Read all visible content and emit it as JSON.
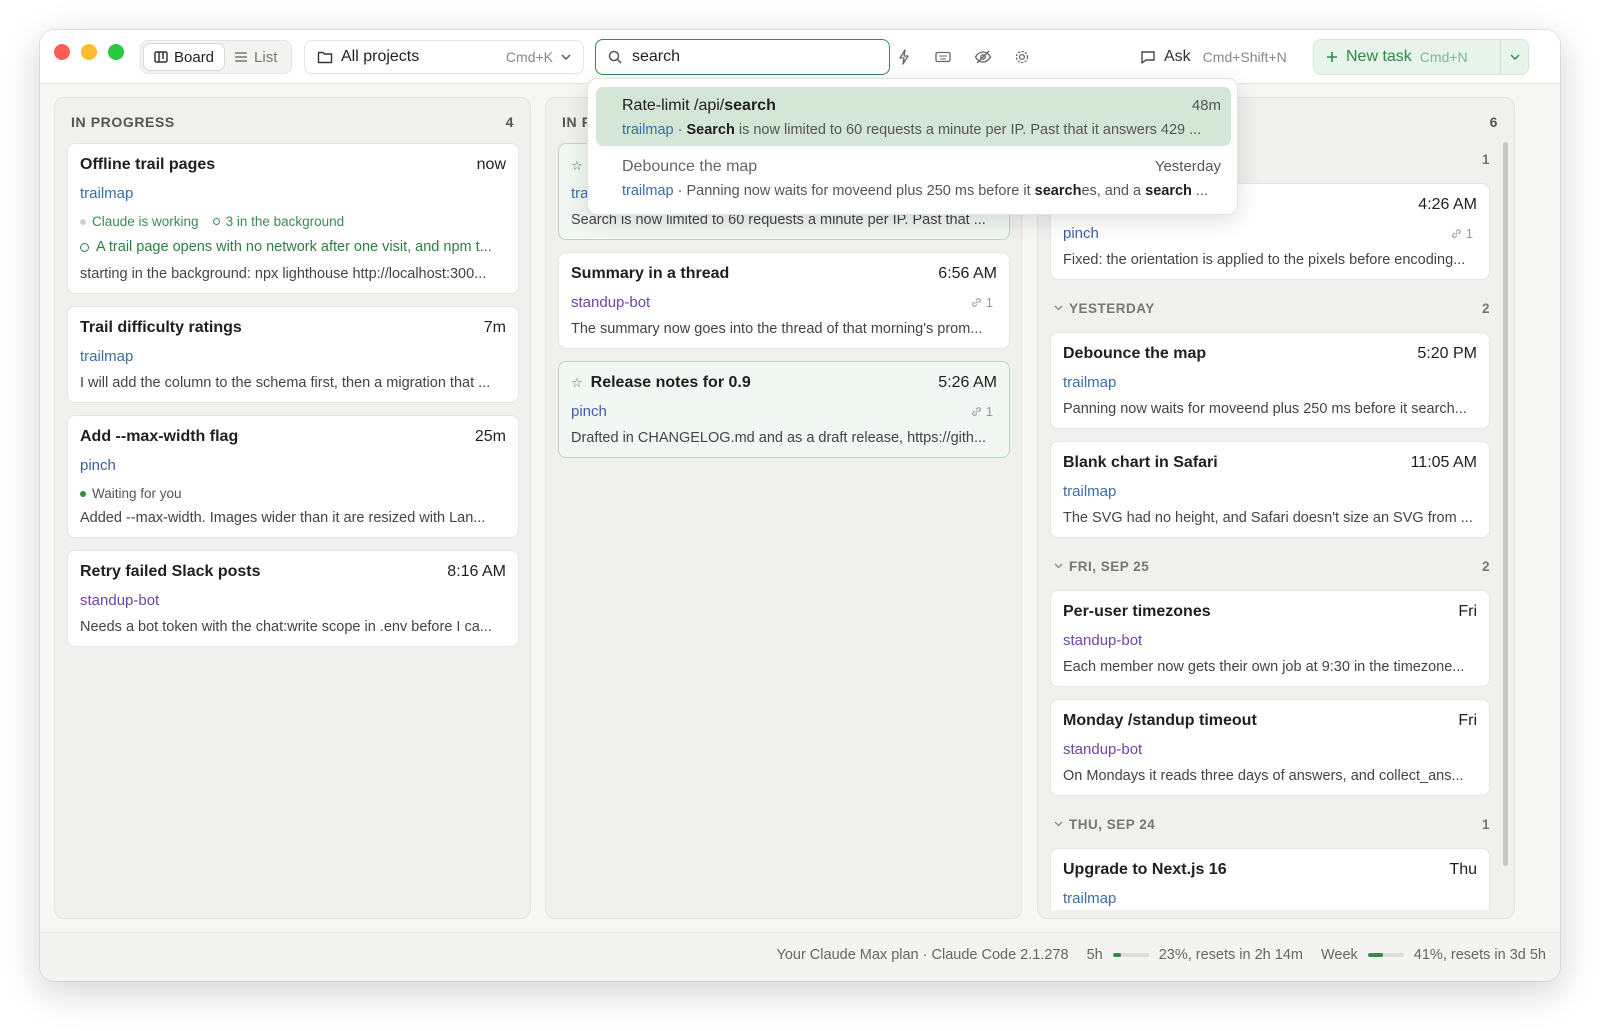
{
  "toolbar": {
    "view_board": "Board",
    "view_list": "List",
    "projects_label": "All projects",
    "projects_kbd": "Cmd+K",
    "search_value": "search",
    "ask_label": "Ask",
    "ask_kbd": "Cmd+Shift+N",
    "new_task_label": "New task",
    "new_task_kbd": "Cmd+N"
  },
  "col1": {
    "title": "IN PROGRESS",
    "count": "4",
    "cards": [
      {
        "title": "Offline trail pages",
        "time": "now",
        "project": "trailmap",
        "status1": "Claude is working",
        "status2": "3 in the background",
        "line1": "A trail page opens with no network after one visit, and npm t...",
        "line2": "starting in the background: npx lighthouse http://localhost:300..."
      },
      {
        "title": "Trail difficulty ratings",
        "time": "7m",
        "project": "trailmap",
        "line1": "I will add the column to the schema first, then a migration that ..."
      },
      {
        "title": "Add --max-width flag",
        "time": "25m",
        "project": "pinch",
        "status1": "Waiting for you",
        "line1": "Added --max-width. Images wider than it are resized with Lan..."
      },
      {
        "title": "Retry failed Slack posts",
        "time": "8:16 AM",
        "project": "standup-bot",
        "line1": "Needs a bot token with the chat:write scope in .env before I ca..."
      }
    ]
  },
  "col2": {
    "title": "IN R",
    "cards": [
      {
        "project": "tra",
        "line1": "Search is now limited to 60 requests a minute per IP. Past that ..."
      },
      {
        "title": "Summary in a thread",
        "time": "6:56 AM",
        "project": "standup-bot",
        "links": "1",
        "line1": "The summary now goes into the thread of that morning's prom..."
      },
      {
        "title": "Release notes for 0.9",
        "time": "5:26 AM",
        "project": "pinch",
        "links": "1",
        "line1": "Drafted in CHANGELOG.md and as a draft release, https://gith..."
      }
    ]
  },
  "col3": {
    "count": "6",
    "groups": [
      {
        "count": "1"
      },
      {
        "label": "YESTERDAY",
        "count": "2"
      },
      {
        "label": "FRI, SEP 25",
        "count": "2"
      },
      {
        "label": "THU, SEP 24",
        "count": "1"
      }
    ],
    "cards": [
      {
        "time": "4:26 AM",
        "project": "pinch",
        "links": "1",
        "line1": "Fixed: the orientation is applied to the pixels before encoding..."
      },
      {
        "title": "Debounce the map",
        "time": "5:20 PM",
        "project": "trailmap",
        "line1": "Panning now waits for moveend plus 250 ms before it search..."
      },
      {
        "title": "Blank chart in Safari",
        "time": "11:05 AM",
        "project": "trailmap",
        "line1": "The SVG had no height, and Safari doesn't size an SVG from ..."
      },
      {
        "title": "Per-user timezones",
        "time": "Fri",
        "project": "standup-bot",
        "line1": "Each member now gets their own job at 9:30 in the timezone..."
      },
      {
        "title": "Monday /standup timeout",
        "time": "Fri",
        "project": "standup-bot",
        "line1": "On Mondays it reads three days of answers, and collect_ans..."
      },
      {
        "title": "Upgrade to Next.js 16",
        "time": "Thu",
        "project": "trailmap"
      }
    ]
  },
  "dropdown": {
    "items": [
      {
        "title_pre": "Rate-limit /api/",
        "title_bold": "search",
        "time": "48m",
        "project": "trailmap",
        "sep": " · ",
        "sub_bold": "Search",
        "sub_rest": " is now limited to 60 requests a minute per IP. Past that it answers 429 ..."
      },
      {
        "title": "Debounce the map",
        "time": "Yesterday",
        "project": "trailmap",
        "sep": " · ",
        "sub_pre": "Panning now waits for moveend plus 250 ms before it ",
        "sub_bold1": "search",
        "sub_mid": "es, and a ",
        "sub_bold2": "search",
        "sub_end": " ..."
      }
    ]
  },
  "statusbar": {
    "plan": "Your Claude Max plan · Claude Code 2.1.278",
    "five_h_label": "5h",
    "five_h_pct": 23,
    "five_h_text": "23%, resets in 2h 14m",
    "week_label": "Week",
    "week_pct": 41,
    "week_text": "41%, resets in 3d 5h"
  },
  "colors": {
    "accent": "#2f8c4a",
    "trailmap": "#3b6ea5",
    "pinch": "#3b5fa5",
    "standup_bot": "#7045a5"
  }
}
